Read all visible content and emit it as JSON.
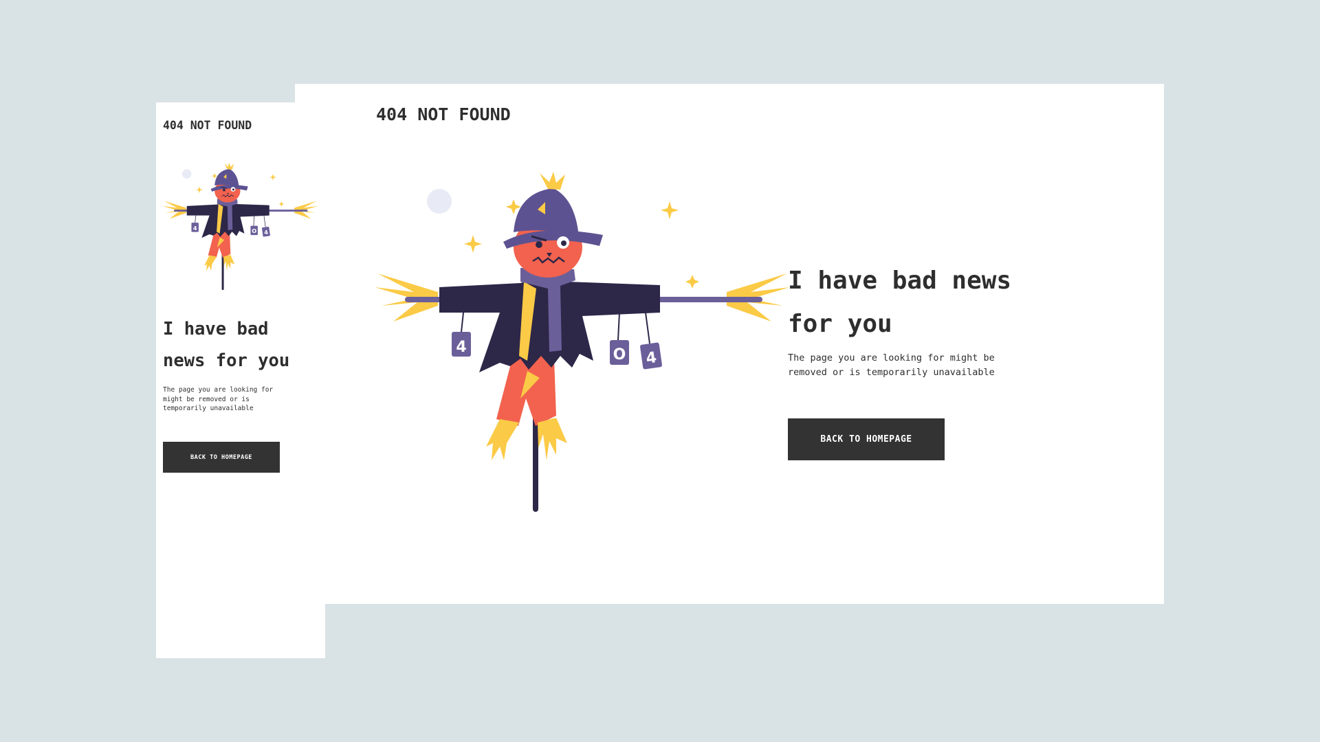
{
  "page": {
    "brand": "404 NOT FOUND",
    "headline": "I have bad news for you",
    "headline_mobile_line1": "I have bad",
    "headline_mobile_line2": "news for you",
    "headline_desktop_line1": "I have bad news",
    "headline_desktop_line2": "for you",
    "description": "The page you are looking for might be removed or is temporarily unavailable",
    "button_label": "BACK TO HOMEPAGE"
  },
  "illustration": {
    "subject": "scarecrow-icon",
    "can_labels": [
      "4",
      "0",
      "4"
    ]
  },
  "colors": {
    "background": "#d9e2e4",
    "card": "#ffffff",
    "text": "#2e2e2e",
    "button": "#333333",
    "coat": "#2d2748",
    "hat": "#5d5291",
    "face": "#f2624e",
    "straw": "#fbca46",
    "scarf": "#6b5f9a"
  }
}
